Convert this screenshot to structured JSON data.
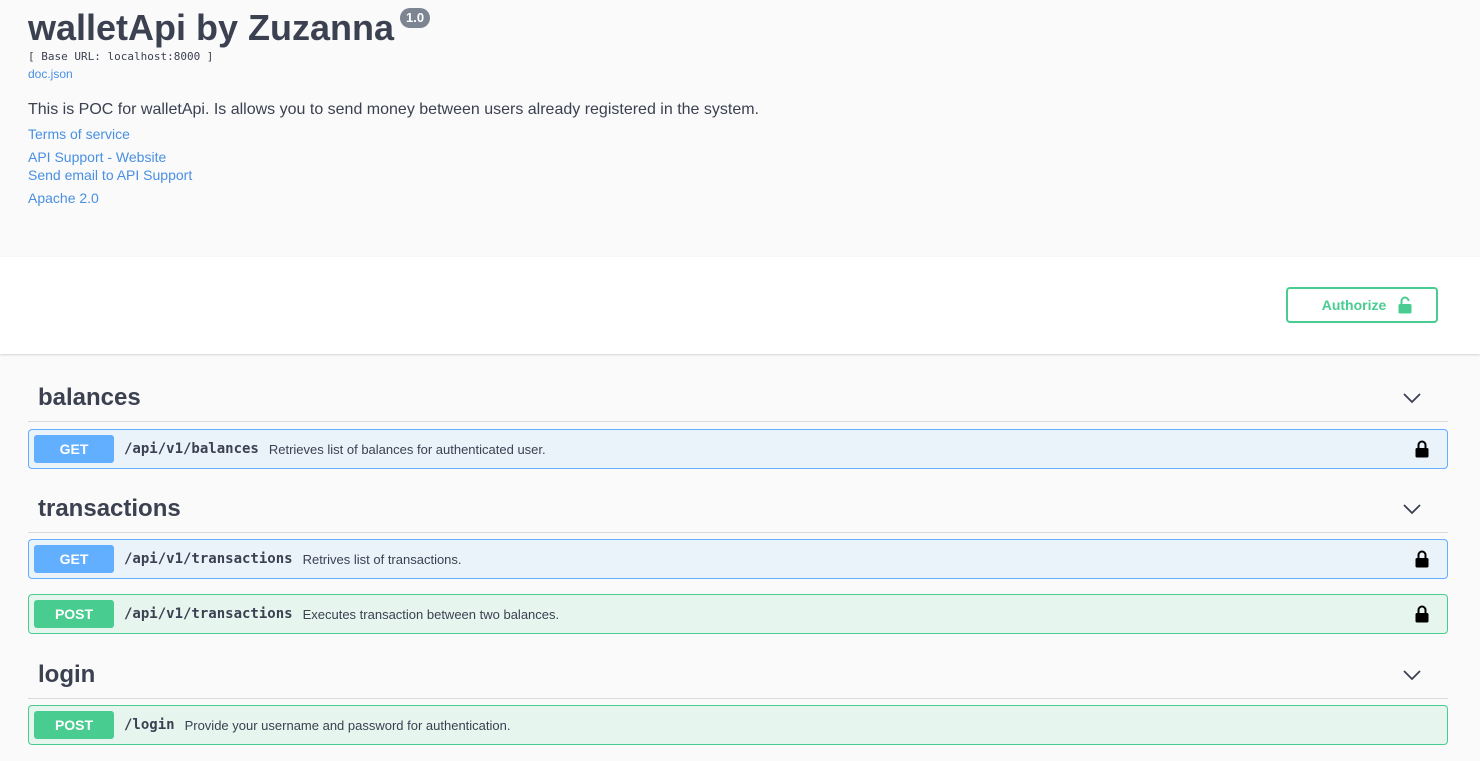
{
  "info": {
    "title": "walletApi by Zuzanna",
    "version": "1.0",
    "base_url": "[ Base URL: localhost:8000 ]",
    "doc_link": "doc.json",
    "description": "This is POC for walletApi. Is allows you to send money between users already registered in the system.",
    "links": {
      "terms": "Terms of service",
      "website": "API Support - Website",
      "email": "Send email to API Support",
      "license": "Apache 2.0"
    }
  },
  "scheme": {
    "authorize_label": "Authorize"
  },
  "tags": [
    {
      "name": "balances",
      "operations": [
        {
          "method": "GET",
          "path": "/api/v1/balances",
          "summary": "Retrieves list of balances for authenticated user.",
          "locked": true
        }
      ]
    },
    {
      "name": "transactions",
      "operations": [
        {
          "method": "GET",
          "path": "/api/v1/transactions",
          "summary": "Retrives list of transactions.",
          "locked": true
        },
        {
          "method": "POST",
          "path": "/api/v1/transactions",
          "summary": "Executes transaction between two balances.",
          "locked": true
        }
      ]
    },
    {
      "name": "login",
      "operations": [
        {
          "method": "POST",
          "path": "/login",
          "summary": "Provide your username and password for authentication.",
          "locked": false
        }
      ]
    }
  ],
  "colors": {
    "get": "#61affe",
    "post": "#49cc90",
    "link": "#4990e2",
    "text": "#3b4151"
  },
  "icons": {
    "lock": "lock-icon",
    "chevron": "chevron-down-icon",
    "authorize_lock": "unlocked-icon"
  }
}
